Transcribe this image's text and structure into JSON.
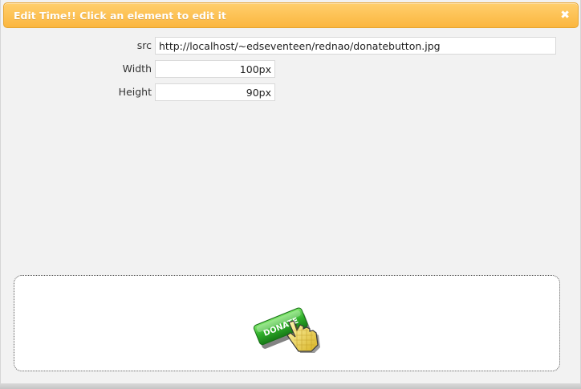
{
  "dialog": {
    "title": "Edit Time!! Click an element to edit it",
    "close_glyph": "✖"
  },
  "form": {
    "src": {
      "label": "src",
      "value": "http://localhost/~edseventeen/rednao/donatebutton.jpg"
    },
    "width": {
      "label": "Width",
      "value": "100px"
    },
    "height": {
      "label": "Height",
      "value": "90px"
    }
  },
  "preview": {
    "button_text": "DONATE",
    "icon": "hand-cursor-icon",
    "button_color": "#2fae2a"
  },
  "colors": {
    "titlebar": "#fbb63f",
    "title_text": "#ffffff"
  }
}
